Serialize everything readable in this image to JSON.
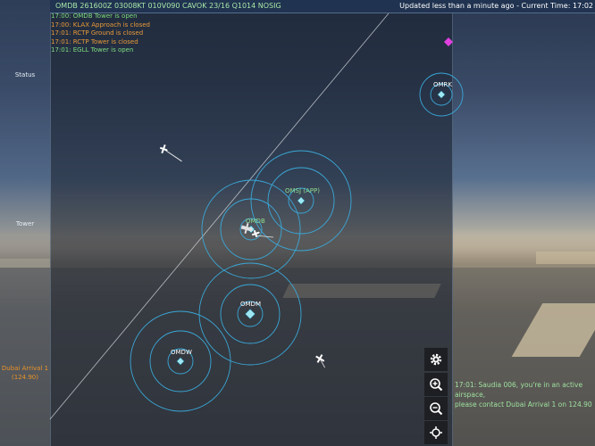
{
  "topbar": {
    "metar": "OMDB 261600Z 03008KT 010V090 CAVOK 23/16 Q1014 NOSIG",
    "updated": "Updated less than a minute ago - Current Time: 17:02"
  },
  "log": [
    {
      "text": "17:00: OMDB Tower is open",
      "color": "green"
    },
    {
      "text": "17:00: KLAX Approach is closed",
      "color": "orange"
    },
    {
      "text": "17:01: RCTP Ground is closed",
      "color": "orange"
    },
    {
      "text": "17:01: RCTP Tower is closed",
      "color": "orange"
    },
    {
      "text": "17:01: EGLL Tower is open",
      "color": "green"
    }
  ],
  "left_panel": {
    "status": "Status",
    "tower": "Tower",
    "arrival_name": "Dubai Arrival 1",
    "arrival_freq": "(124.90)"
  },
  "stations": {
    "omrk": "OMRK",
    "omsj": "OMSJ (APP)",
    "omdb": "OMDB",
    "omdm": "OMDM",
    "omdw": "OMDW"
  },
  "controls": {
    "settings": "gear-icon",
    "zoom_in": "zoom-in-icon",
    "zoom_out": "zoom-out-icon",
    "recenter": "crosshair-icon"
  },
  "message": {
    "line1": "17:01: Saudia 006, you're in an active airspace,",
    "line2": "please contact Dubai Arrival 1 on 124.90"
  },
  "colors": {
    "ring": "#3aa8d8",
    "station_label": "#ffffff",
    "approach_label": "#8fdc8f",
    "arrival_label": "#e8922a",
    "message": "#9fe29f"
  }
}
